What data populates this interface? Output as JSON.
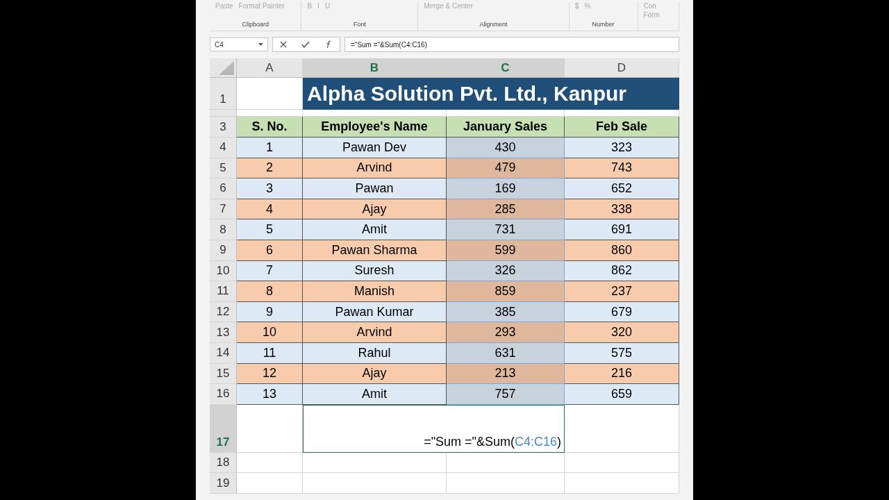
{
  "ribbon": {
    "groups": [
      {
        "label": "Clipboard",
        "items": [
          "Paste",
          "Format Painter"
        ]
      },
      {
        "label": "Font",
        "items": [
          "B",
          "I",
          "U"
        ]
      },
      {
        "label": "Alignment",
        "items": [
          "Merge & Center"
        ]
      },
      {
        "label": "Number",
        "items": [
          "$",
          "%"
        ]
      },
      {
        "items": [
          "Con",
          "Form"
        ]
      }
    ]
  },
  "formula_bar": {
    "name_box": "C4",
    "formula": "=\"Sum =\"&Sum(C4:C16)"
  },
  "columns": [
    {
      "label": "A",
      "selected": false,
      "in_reference": false
    },
    {
      "label": "B",
      "selected": true,
      "in_reference": false
    },
    {
      "label": "C",
      "selected": true,
      "in_reference": true
    },
    {
      "label": "D",
      "selected": false,
      "in_reference": false
    }
  ],
  "title": {
    "row": "1",
    "text": "Alpha Solution Pvt. Ltd., Kanpur"
  },
  "header": {
    "row": "3",
    "cells": [
      "S. No.",
      "Employee's Name",
      "January Sales",
      "Feb Sale"
    ]
  },
  "rows": [
    {
      "row": "4",
      "cells": [
        "1",
        "Pawan Dev",
        "430",
        "323"
      ],
      "color": "#dde9f5",
      "in_reference": true
    },
    {
      "row": "5",
      "cells": [
        "2",
        "Arvind",
        "479",
        "743"
      ],
      "color": "#f8cbad",
      "in_reference": true
    },
    {
      "row": "6",
      "cells": [
        "3",
        "Pawan",
        "169",
        "652"
      ],
      "color": "#dde9f5",
      "in_reference": true
    },
    {
      "row": "7",
      "cells": [
        "4",
        "Ajay",
        "285",
        "338"
      ],
      "color": "#f8cbad",
      "in_reference": true
    },
    {
      "row": "8",
      "cells": [
        "5",
        "Amit",
        "731",
        "691"
      ],
      "color": "#dde9f5",
      "in_reference": true
    },
    {
      "row": "9",
      "cells": [
        "6",
        "Pawan Sharma",
        "599",
        "860"
      ],
      "color": "#f8cbad",
      "in_reference": true
    },
    {
      "row": "10",
      "cells": [
        "7",
        "Suresh",
        "326",
        "862"
      ],
      "color": "#dde9f5",
      "in_reference": true
    },
    {
      "row": "11",
      "cells": [
        "8",
        "Manish",
        "859",
        "237"
      ],
      "color": "#f8cbad",
      "in_reference": true
    },
    {
      "row": "12",
      "cells": [
        "9",
        "Pawan Kumar",
        "385",
        "679"
      ],
      "color": "#dde9f5",
      "in_reference": true
    },
    {
      "row": "13",
      "cells": [
        "10",
        "Arvind",
        "293",
        "320"
      ],
      "color": "#f8cbad",
      "in_reference": true
    },
    {
      "row": "14",
      "cells": [
        "11",
        "Rahul",
        "631",
        "575"
      ],
      "color": "#dde9f5",
      "in_reference": true
    },
    {
      "row": "15",
      "cells": [
        "12",
        "Ajay",
        "213",
        "216"
      ],
      "color": "#f8cbad",
      "in_reference": true
    },
    {
      "row": "16",
      "cells": [
        "13",
        "Amit",
        "757",
        "659"
      ],
      "color": "#dde9f5",
      "in_reference": true
    }
  ],
  "edit_row": {
    "row": "17",
    "selected": true,
    "formula_start": "=\"Sum =\"&Sum(",
    "formula_reference": "C4:C16",
    "formula_end": ")"
  },
  "empty_rows": [
    "18",
    "19"
  ]
}
